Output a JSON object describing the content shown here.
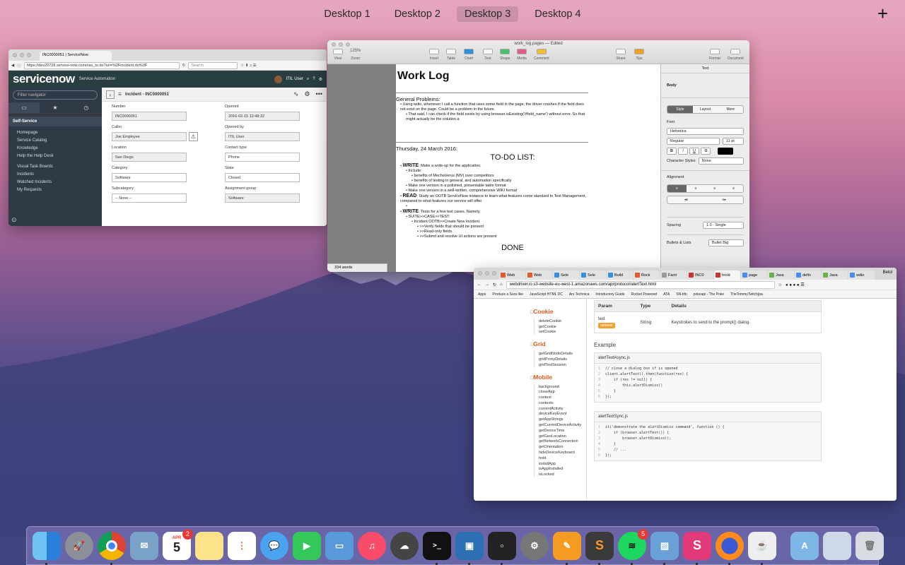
{
  "desktops": [
    "Desktop 1",
    "Desktop 2",
    "Desktop 3",
    "Desktop 4"
  ],
  "active_desktop": "Desktop 3",
  "add_desktop": "+",
  "servicenow": {
    "tab_title": "INC0000051 | ServiceNow",
    "url": "https://dev20728.service-now.com/nav_to.do?uri=%2Fincident.do%3F",
    "search_placeholder": "Search",
    "logo": "servicenow",
    "subtitle": "Service Automation",
    "user": "ITIL User",
    "filter_placeholder": "Filter navigator",
    "section": "Self-Service",
    "nav": [
      "Homepage",
      "Service Catalog",
      "Knowledge",
      "Help the Help Desk",
      "Visual Task Boards",
      "Incidents",
      "Watched Incidents",
      "My Requests"
    ],
    "form_title": "Incident - INC0000051",
    "fields": {
      "number_label": "Number",
      "number": "INC0000051",
      "opened_label": "Opened",
      "opened": "2016-02-15 12:48:32",
      "caller_label": "Caller",
      "caller": "Joe Employee",
      "opened_by_label": "Opened by",
      "opened_by": "ITIL User",
      "location_label": "Location",
      "location": "San Diego",
      "contact_type_label": "Contact type",
      "contact_type": "Phone",
      "category_label": "Category",
      "category": "Software",
      "state_label": "State",
      "state": "Closed",
      "subcategory_label": "Subcategory",
      "subcategory": "-- None --",
      "assignment_group_label": "Assignment group",
      "assignment_group": "Software"
    }
  },
  "pages": {
    "window_title": "work_log.pages — Edited",
    "toolbar": [
      "View",
      "Zoom",
      "Insert",
      "Table",
      "Chart",
      "Text",
      "Shape",
      "Media",
      "Comment",
      "Share",
      "Tips",
      "Format",
      "Document"
    ],
    "zoom": "125%",
    "title": "Work Log",
    "general": "General Problems:",
    "g1": "Using wdio, whenever I call a function that uses some field in the page, the driver crashes if the field does not exist on the page. Could be a problem in the future.",
    "g2": "That said, I can check if the field exists by using browser.isExisting('#field_name') without error. So that might actually be the solution.a",
    "date": "Thursday, 24 March 2016:",
    "todo": "TO-DO LIST:",
    "write_label": "WRITE",
    "write_text": ": Make a write-up for the application.",
    "include": "Include:",
    "inc1": "benefits of MechaVerus (MV) over competitors",
    "inc2": "benefits of testing in general, and automation specifically",
    "polished": "Make one version in a polished, presentable table format",
    "wiki": "Make one version in a well-written, comprehensive WIKI format",
    "read_label": "READ",
    "read_text": ": Study an OOTB ServiceNow instance to learn what features come standard in Test Management, compared to what features our service will offer.",
    "write2_text": ": Tests for a few test cases. Namely,",
    "suite": "SUITE>>CASE>>TEST:",
    "incident": "Incident OOTB>>Create New Incident",
    "t1": ">>Verify fields that should be present",
    "t2": ">>Read-only fields",
    "t3": ">>Submit and resolve UI actions are present",
    "done": "DONE",
    "word_count": "334 words",
    "inspector": {
      "tab": "Text",
      "style": "Body",
      "seg": [
        "Style",
        "Layout",
        "More"
      ],
      "font_label": "Font",
      "font": "Helvetica",
      "weight": "Regular",
      "size": "11 pt",
      "char_label": "Character Styles",
      "char_value": "None",
      "align_label": "Alignment",
      "spacing_label": "Spacing",
      "spacing": "1.0 - Single",
      "bullets_label": "Bullets & Lists",
      "bullets": "Bullet Big"
    }
  },
  "chrome": {
    "tabs": [
      "Web",
      "Web",
      "Sele",
      "Sele",
      "Build",
      "Rock",
      "Factr",
      "INC0",
      "Incid",
      "page",
      "Java",
      "defin",
      "Java",
      "wdio"
    ],
    "profile": "Belol",
    "url": "webdriver.io.s3-website-eu-west-1.amazonaws.com/api/protocol/alertText.html",
    "bookmarks": [
      "Apps",
      "Produce a Sura like",
      "JavaScript HTML DC",
      "Ars Technica",
      "Introductory Guide",
      "Rocket Powered",
      "ATA",
      "SN-bfn",
      "pokeapi - The Poke",
      "TheTommyTwitch|pa"
    ],
    "sections": [
      {
        "title": "Cookie",
        "items": [
          "deleteCookie",
          "getCookie",
          "setCookie"
        ]
      },
      {
        "title": "Grid",
        "items": [
          "getGridNodeDetails",
          "gridProxyDetails",
          "gridTestSession"
        ]
      },
      {
        "title": "Mobile",
        "items": [
          "background",
          "closeApp",
          "context",
          "contexts",
          "currentActivity",
          "deviceKeyEvent",
          "getAppStrings",
          "getCurrentDeviceActivity",
          "getDeviceTime",
          "getGeoLocation",
          "getNetworkConnection",
          "getOrientation",
          "hideDeviceKeyboard",
          "hold",
          "installApp",
          "isAppInstalled",
          "isLocked"
        ]
      }
    ],
    "table_headers": [
      "Param",
      "Type",
      "Details"
    ],
    "param": "text",
    "optional": "optional",
    "type": "String",
    "details": "Keystrokes to send to the prompt() dialog.",
    "example": "Example",
    "code1_name": "alertTextAsync.js",
    "code1": [
      "// close a dialog box if is opened",
      "client.alertText().then(function(res) {",
      "    if (res != null) {",
      "        this.alertDismiss()",
      "    }",
      "});"
    ],
    "code2_name": "alertTextSync.js",
    "code2": [
      "it('demonstrate the alertDismiss command', function () {",
      "    if (browser.alertText()) {",
      "        browser.alertDismiss();",
      "    }",
      "    // ...",
      "});"
    ]
  },
  "dock": [
    "finder",
    "launchpad",
    "chrome",
    "mail",
    "calendar",
    "notes",
    "reminders",
    "messages",
    "facetime",
    "keynote",
    "itunes",
    "cloudapp",
    "terminal",
    "virtualbox",
    "tableflip",
    "system-preferences",
    "pages",
    "sublime-text",
    "spotify",
    "preview",
    "skitch",
    "firefox",
    "java",
    "applications-folder",
    "downloads",
    "trash"
  ],
  "dock_badges": {
    "calendar": "2",
    "spotify": "5"
  },
  "calendar_month": "APR",
  "calendar_day": "5",
  "colors": {
    "servicenow_header": "#293e40",
    "accent_orange": "#e0591d",
    "badge_red": "#e53935"
  }
}
